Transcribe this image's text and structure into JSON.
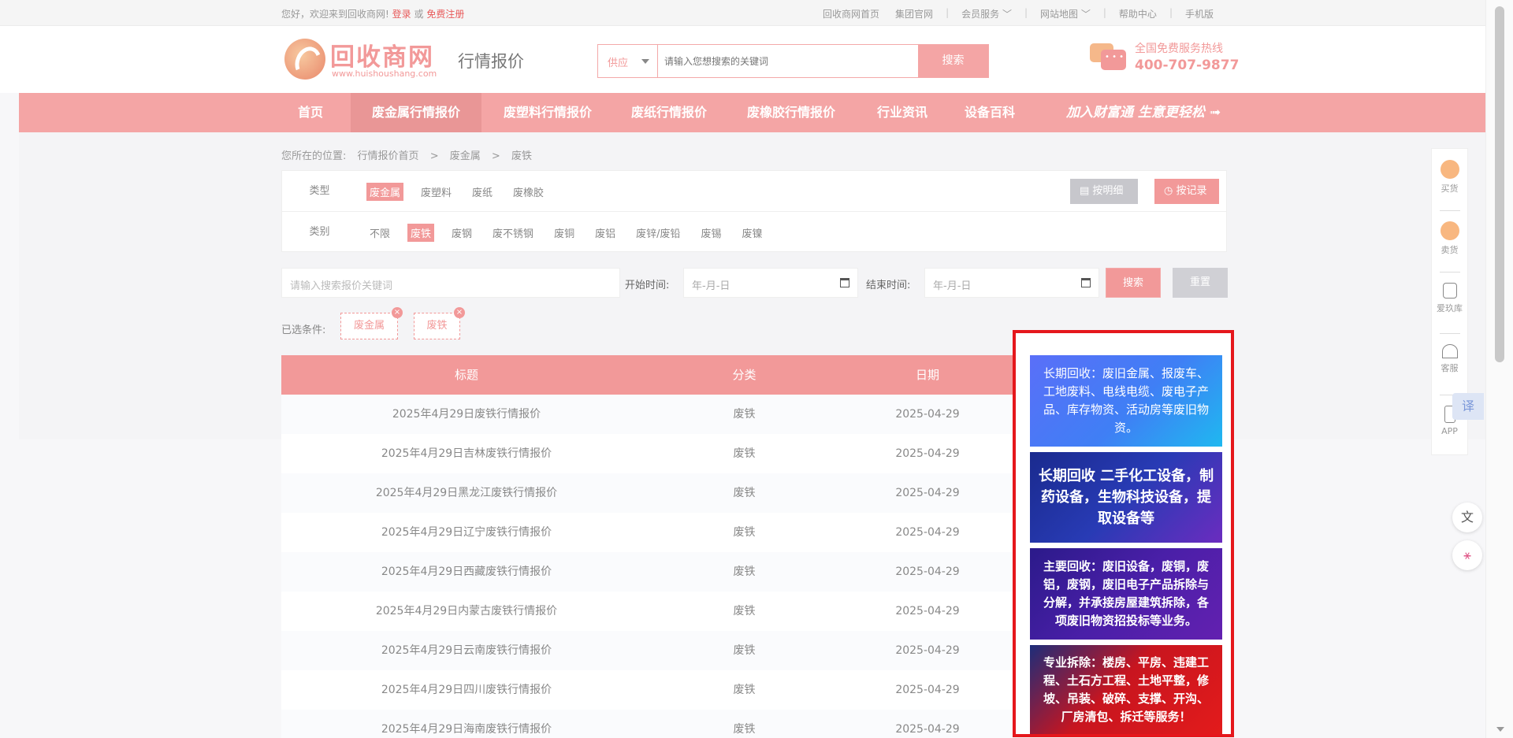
{
  "topbar": {
    "welcome": "您好，欢迎来到回收商网!",
    "login": "登录",
    "or": "或",
    "register": "免费注册",
    "links": [
      "回收商网首页",
      "集团官网",
      "会员服务",
      "网站地图",
      "帮助中心",
      "手机版"
    ]
  },
  "header": {
    "logo_name": "回收商网",
    "logo_url": "www.huishoushang.com",
    "subtitle": "行情报价",
    "search_type": "供应",
    "search_placeholder": "请输入您想搜索的关键词",
    "search_button": "搜索",
    "hotline_label": "全国免费服务热线",
    "hotline_phone": "400-707-9877"
  },
  "nav": {
    "items": [
      "首页",
      "废金属行情报价",
      "废塑料行情报价",
      "废纸行情报价",
      "废橡胶行情报价",
      "行业资讯",
      "设备百科"
    ],
    "active_index": 1,
    "slogan": "加入财富通 生意更轻松 ➟"
  },
  "breadcrumb": [
    "您所在的位置:",
    "行情报价首页",
    ">",
    "废金属",
    ">",
    "废铁"
  ],
  "filter": {
    "type_label": "类型",
    "types": [
      "废金属",
      "废塑料",
      "废纸",
      "废橡胶"
    ],
    "category_label": "类别",
    "categories": [
      "不限",
      "废铁",
      "废钢",
      "废不锈钢",
      "废铜",
      "废铝",
      "废锌/废铅",
      "废锡",
      "废镍"
    ],
    "btn_detail": "按明细",
    "btn_record": "按记录"
  },
  "query": {
    "keyword_placeholder": "请输入搜索报价关键词",
    "start_label": "开始时间:",
    "end_label": "结束时间:",
    "date_placeholder": "年-月-日",
    "search": "搜索",
    "reset": "重置"
  },
  "chosen": {
    "label": "已选条件:",
    "tags": [
      "废金属",
      "废铁"
    ]
  },
  "table": {
    "headers": [
      "标题",
      "分类",
      "日期"
    ],
    "rows": [
      [
        "2025年4月29日废铁行情报价",
        "废铁",
        "2025-04-29"
      ],
      [
        "2025年4月29日吉林废铁行情报价",
        "废铁",
        "2025-04-29"
      ],
      [
        "2025年4月29日黑龙江废铁行情报价",
        "废铁",
        "2025-04-29"
      ],
      [
        "2025年4月29日辽宁废铁行情报价",
        "废铁",
        "2025-04-29"
      ],
      [
        "2025年4月29日西藏废铁行情报价",
        "废铁",
        "2025-04-29"
      ],
      [
        "2025年4月29日内蒙古废铁行情报价",
        "废铁",
        "2025-04-29"
      ],
      [
        "2025年4月29日云南废铁行情报价",
        "废铁",
        "2025-04-29"
      ],
      [
        "2025年4月29日四川废铁行情报价",
        "废铁",
        "2025-04-29"
      ],
      [
        "2025年4月29日海南废铁行情报价",
        "废铁",
        "2025-04-29"
      ]
    ]
  },
  "ads": [
    "长期回收：废旧金属、报废车、工地废料、电线电缆、废电子产品、库存物资、活动房等废旧物资。",
    "长期回收 二手化工设备，制药设备，生物科技设备，提取设备等",
    "主要回收：废旧设备，废铜，废铝，废钢，废旧电子产品拆除与分解，并承接房屋建筑拆除，各项废旧物资招投标等业务。",
    "专业拆除：楼房、平房、违建工程、土石方工程、土地平整，修坡、吊装、破碎、支撑、开沟、厂房清包、拆迁等服务！"
  ],
  "sidebar": [
    "买货",
    "卖货",
    "爱玖库",
    "客服",
    "APP"
  ],
  "translate_label": "译"
}
